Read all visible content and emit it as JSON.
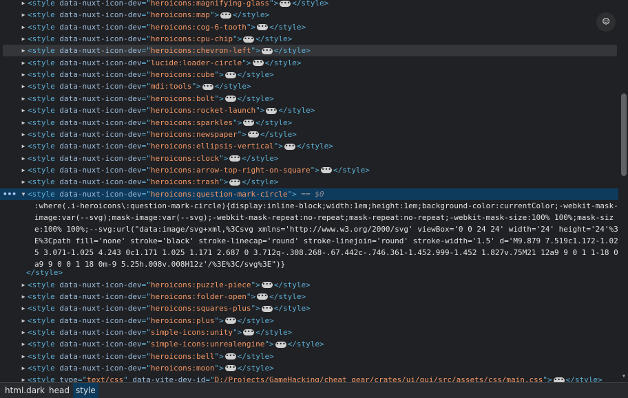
{
  "rows_top": [
    {
      "tag": "style",
      "attr": "data-nuxt-icon-dev",
      "value": "heroicons:magnifying-glass",
      "close": "</style>"
    },
    {
      "tag": "style",
      "attr": "data-nuxt-icon-dev",
      "value": "heroicons:map",
      "close": "</style>"
    },
    {
      "tag": "style",
      "attr": "data-nuxt-icon-dev",
      "value": "heroicons:cog-6-tooth",
      "close": "</style>"
    },
    {
      "tag": "style",
      "attr": "data-nuxt-icon-dev",
      "value": "heroicons:cpu-chip",
      "close": "</style>"
    },
    {
      "tag": "style",
      "attr": "data-nuxt-icon-dev",
      "value": "heroicons:chevron-left",
      "close": "</style>"
    },
    {
      "tag": "style",
      "attr": "data-nuxt-icon-dev",
      "value": "lucide:loader-circle",
      "close": "</style>"
    },
    {
      "tag": "style",
      "attr": "data-nuxt-icon-dev",
      "value": "heroicons:cube",
      "close": "</style>"
    },
    {
      "tag": "style",
      "attr": "data-nuxt-icon-dev",
      "value": "mdi:tools",
      "close": "</style>"
    },
    {
      "tag": "style",
      "attr": "data-nuxt-icon-dev",
      "value": "heroicons:bolt",
      "close": "</style>"
    },
    {
      "tag": "style",
      "attr": "data-nuxt-icon-dev",
      "value": "heroicons:rocket-launch",
      "close": "</style>"
    },
    {
      "tag": "style",
      "attr": "data-nuxt-icon-dev",
      "value": "heroicons:sparkles",
      "close": "</style>"
    },
    {
      "tag": "style",
      "attr": "data-nuxt-icon-dev",
      "value": "heroicons:newspaper",
      "close": "</style>"
    },
    {
      "tag": "style",
      "attr": "data-nuxt-icon-dev",
      "value": "heroicons:ellipsis-vertical",
      "close": "</style>"
    },
    {
      "tag": "style",
      "attr": "data-nuxt-icon-dev",
      "value": "heroicons:clock",
      "close": "</style>"
    },
    {
      "tag": "style",
      "attr": "data-nuxt-icon-dev",
      "value": "heroicons:arrow-top-right-on-square",
      "close": "</style>"
    },
    {
      "tag": "style",
      "attr": "data-nuxt-icon-dev",
      "value": "heroicons:trash",
      "close": "</style>"
    }
  ],
  "selected": {
    "tag": "style",
    "attr": "data-nuxt-icon-dev",
    "value": "heroicons:question-mark-circle",
    "marker": "== $0",
    "css_text": ":where(.i-heroicons\\:question-mark-circle){display:inline-block;width:1em;height:1em;background-color:currentColor;-webkit-mask-image:var(--svg);mask-image:var(--svg);-webkit-mask-repeat:no-repeat;mask-repeat:no-repeat;-webkit-mask-size:100% 100%;mask-size:100% 100%;--svg:url(\"data:image/svg+xml,%3Csvg xmlns='http://www.w3.org/2000/svg' viewBox='0 0 24 24' width='24' height='24'%3E%3Cpath fill='none' stroke='black' stroke-linecap='round' stroke-linejoin='round' stroke-width='1.5' d='M9.879 7.519c1.172-1.025 3.071-1.025 4.243 0c1.171 1.025 1.171 2.687 0 3.712q-.308.268-.67.442c-.746.361-1.452.999-1.452 1.827v.75M21 12a9 9 0 1 1-18 0a9 9 0 0 1 18 0m-9 5.25h.008v.008H12z'/%3E%3C/svg%3E\")}",
    "close": "</style>"
  },
  "rows_bottom": [
    {
      "tag": "style",
      "attr": "data-nuxt-icon-dev",
      "value": "heroicons:puzzle-piece",
      "close": "</style>"
    },
    {
      "tag": "style",
      "attr": "data-nuxt-icon-dev",
      "value": "heroicons:folder-open",
      "close": "</style>"
    },
    {
      "tag": "style",
      "attr": "data-nuxt-icon-dev",
      "value": "heroicons:squares-plus",
      "close": "</style>"
    },
    {
      "tag": "style",
      "attr": "data-nuxt-icon-dev",
      "value": "heroicons:plus",
      "close": "</style>"
    },
    {
      "tag": "style",
      "attr": "data-nuxt-icon-dev",
      "value": "simple-icons:unity",
      "close": "</style>"
    },
    {
      "tag": "style",
      "attr": "data-nuxt-icon-dev",
      "value": "simple-icons:unrealengine",
      "close": "</style>"
    },
    {
      "tag": "style",
      "attr": "data-nuxt-icon-dev",
      "value": "heroicons:bell",
      "close": "</style>"
    },
    {
      "tag": "style",
      "attr": "data-nuxt-icon-dev",
      "value": "heroicons:moon",
      "close": "</style>"
    }
  ],
  "last_row": {
    "tag": "style",
    "attrs": [
      {
        "name": "type",
        "value": "text/css"
      },
      {
        "name": "data-vite-dev-id",
        "value": "D:/Projects/GameHacking/cheat_gear/crates/ui/gui/src/assets/css/main.css"
      }
    ],
    "close": "</style>"
  },
  "breadcrumbs": [
    "html.dark",
    "head",
    "style"
  ],
  "hover_index": 4,
  "accessibility_icon": "accessibility-icon",
  "colors": {
    "tag": "#5db0d7",
    "attr": "#9bbbdc",
    "value": "#f29766",
    "selected_bg": "#0e3a5c"
  }
}
